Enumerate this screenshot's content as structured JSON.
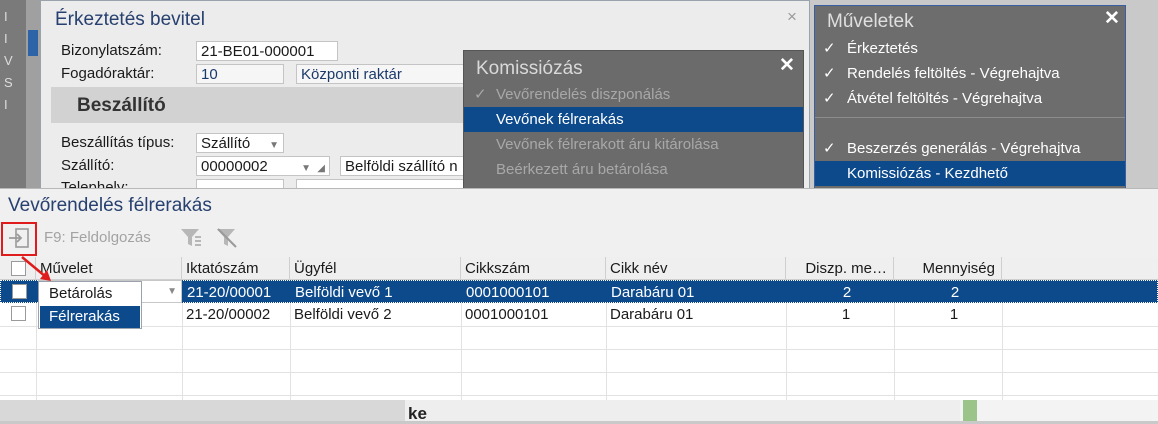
{
  "background": {
    "bottom_text": "ke",
    "left_letters": [
      "I",
      "I",
      "V",
      "S",
      "I"
    ]
  },
  "erkeztetes": {
    "title": "Érkeztetés bevitel",
    "close": "×",
    "fields": {
      "bizonylatszam_label": "Bizonylatszám:",
      "bizonylatszam_value": "21-BE01-000001",
      "fogadoraktar_label": "Fogadóraktár:",
      "fogadoraktar_code": "10",
      "fogadoraktar_name": "Központi raktár"
    },
    "section": "Beszállító",
    "beszallitas_tipus_label": "Beszállítás típus:",
    "beszallitas_tipus_value": "Szállító",
    "szallito_label": "Szállító:",
    "szallito_code": "00000002",
    "szallito_name": "Belföldi szállító n",
    "telephely_label": "Telephely:"
  },
  "komissiozas": {
    "title": "Komissiózás",
    "close": "✕",
    "items": [
      {
        "label": "Vevőrendelés diszponálás",
        "checked": true,
        "selected": false
      },
      {
        "label": "Vevőnek félrerakás",
        "checked": false,
        "selected": true
      },
      {
        "label": "Vevőnek félrerakott áru kitárolása",
        "checked": false,
        "selected": false
      },
      {
        "label": "Beérkezett áru betárolása",
        "checked": false,
        "selected": false
      }
    ]
  },
  "muveletek": {
    "title": "Műveletek",
    "close": "✕",
    "items": [
      {
        "label": "Érkeztetés",
        "checked": true,
        "selected": false
      },
      {
        "label": "Rendelés feltöltés - Végrehajtva",
        "checked": true,
        "selected": false
      },
      {
        "label": "Átvétel feltöltés - Végrehajtva",
        "checked": true,
        "selected": false
      },
      {
        "label": "Beszerzés generálás - Végrehajtva",
        "checked": true,
        "selected": false
      },
      {
        "label": "Komissiózás - Kezdhető",
        "checked": false,
        "selected": true
      }
    ]
  },
  "main": {
    "title": "Vevőrendelés félrerakás",
    "toolbar": {
      "process_label": "F9: Feldolgozás",
      "process_icon": "process-arrow-icon",
      "filter_icon": "filter-icon",
      "clear_filter_icon": "filter-clear-icon"
    },
    "columns": [
      "Művelet",
      "Iktatószám",
      "Ügyfél",
      "Cikkszám",
      "Cikk név",
      "Diszp. me…",
      "Mennyiség"
    ],
    "rows": [
      {
        "muvelet": "Betárolás",
        "iktatoszam": "21-20/00001",
        "ugyfel": "Belföldi vevő 1",
        "cikkszam": "0001000101",
        "cikknev": "Darabáru 01",
        "diszp": "2",
        "mennyiseg": "2",
        "selected": true
      },
      {
        "muvelet": "",
        "iktatoszam": "21-20/00002",
        "ugyfel": "Belföldi vevő 2",
        "cikkszam": "0001000101",
        "cikknev": "Darabáru 01",
        "diszp": "1",
        "mennyiseg": "1",
        "selected": false
      }
    ],
    "dropdown_options": [
      "Betárolás",
      "Félrerakás"
    ],
    "dropdown_selected": "Félrerakás"
  },
  "colors": {
    "selection": "#0d4a8c",
    "title": "#27406f",
    "highlight_box": "#e01b1b"
  }
}
